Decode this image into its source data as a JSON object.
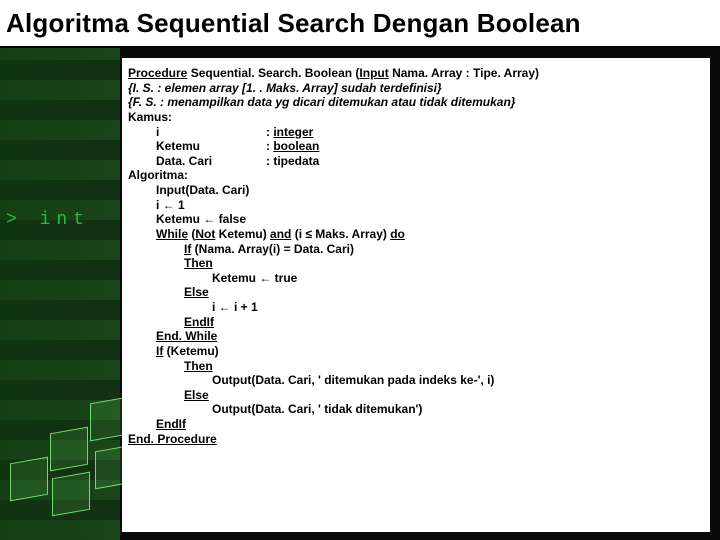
{
  "title": "Algoritma Sequential Search Dengan Boolean",
  "prompt": "> int",
  "code": {
    "proc_kw": "Procedure",
    "proc_name": " Sequential. Search. Boolean (",
    "input_kw": "Input",
    "proc_sig": " Nama. Array : Tipe. Array)",
    "is_line": "{I. S. : elemen array [1. . Maks. Array] sudah terdefinisi}",
    "fs_line": "{F. S. : menampilkan data yg dicari ditemukan atau tidak ditemukan}",
    "kamus": "Kamus:",
    "var_i_name": "i",
    "var_i_type": "integer",
    "var_ketemu_name": "Ketemu",
    "var_ketemu_type": "boolean",
    "var_data_name": "Data. Cari",
    "var_data_type": ": tipedata",
    "algoritma": "Algoritma:",
    "l_input": "Input(Data. Cari)",
    "l_i1_a": "i ",
    "l_i1_b": " 1",
    "l_kfalse_a": "Ketemu ",
    "l_kfalse_b": " false",
    "while_kw": "While",
    "not_kw": "Not",
    "while_mid": " Ketemu) ",
    "and_kw": "and",
    "while_cond": " (i ≤ Maks. Array) ",
    "do_kw": "do",
    "if_kw": "If",
    "if_cond": " (Nama. Array(i) = Data. Cari)",
    "then_kw": "Then",
    "ktrue_a": "Ketemu ",
    "ktrue_b": "  true",
    "else_kw": "Else",
    "iinc_a": "i ",
    "iinc_b": " i + 1",
    "endif_kw": "EndIf",
    "endwhile_kw": "End. While",
    "if2_kw": "If",
    "if2_cond": " (Ketemu)",
    "then2": "Then",
    "out1": "Output(Data. Cari, ' ditemukan pada indeks ke-', i)",
    "else2": "Else",
    "out2": "Output(Data. Cari, ' tidak ditemukan')",
    "endif2": "EndIf",
    "endproc": "End. Procedure",
    "arrow": "←",
    "colon": ": "
  }
}
